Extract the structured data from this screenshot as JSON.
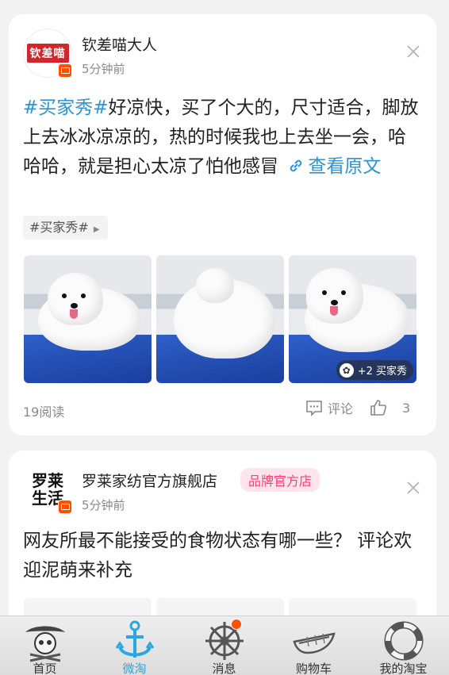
{
  "feed": [
    {
      "avatar_text": "钦差喵",
      "author": "钦差喵大人",
      "time": "5分钟前",
      "hashtag": "#买家秀#",
      "body": "好凉快，买了个大的，尺寸适合，脚放上去冰冰凉凉的，热的时候我也上去坐一会，哈哈哈，就是担心太凉了怕他感冒",
      "link": "查看原文",
      "tag_chip": "#买家秀#",
      "more_badge": "+2 买家秀",
      "reads": "19阅读",
      "comment_label": "评论",
      "like_count": "3"
    },
    {
      "avatar_text": "罗莱生活",
      "author": "罗莱家纺官方旗舰店",
      "badge": "品牌官方店",
      "time": "5分钟前",
      "body": "网友所最不能接受的食物状态有哪一些？ 评论欢迎泥萌来补充"
    }
  ],
  "tabbar": {
    "items": [
      {
        "label": "首页",
        "icon": "pirate-skull-icon"
      },
      {
        "label": "微淘",
        "icon": "anchor-icon",
        "active": true
      },
      {
        "label": "消息",
        "icon": "ship-wheel-icon",
        "badge": true
      },
      {
        "label": "购物车",
        "icon": "boat-icon"
      },
      {
        "label": "我的淘宝",
        "icon": "life-ring-icon"
      }
    ]
  },
  "colors": {
    "accent": "#2b93d8",
    "brand_badge": "#ff3a6e",
    "taobao_orange": "#ff5000"
  }
}
